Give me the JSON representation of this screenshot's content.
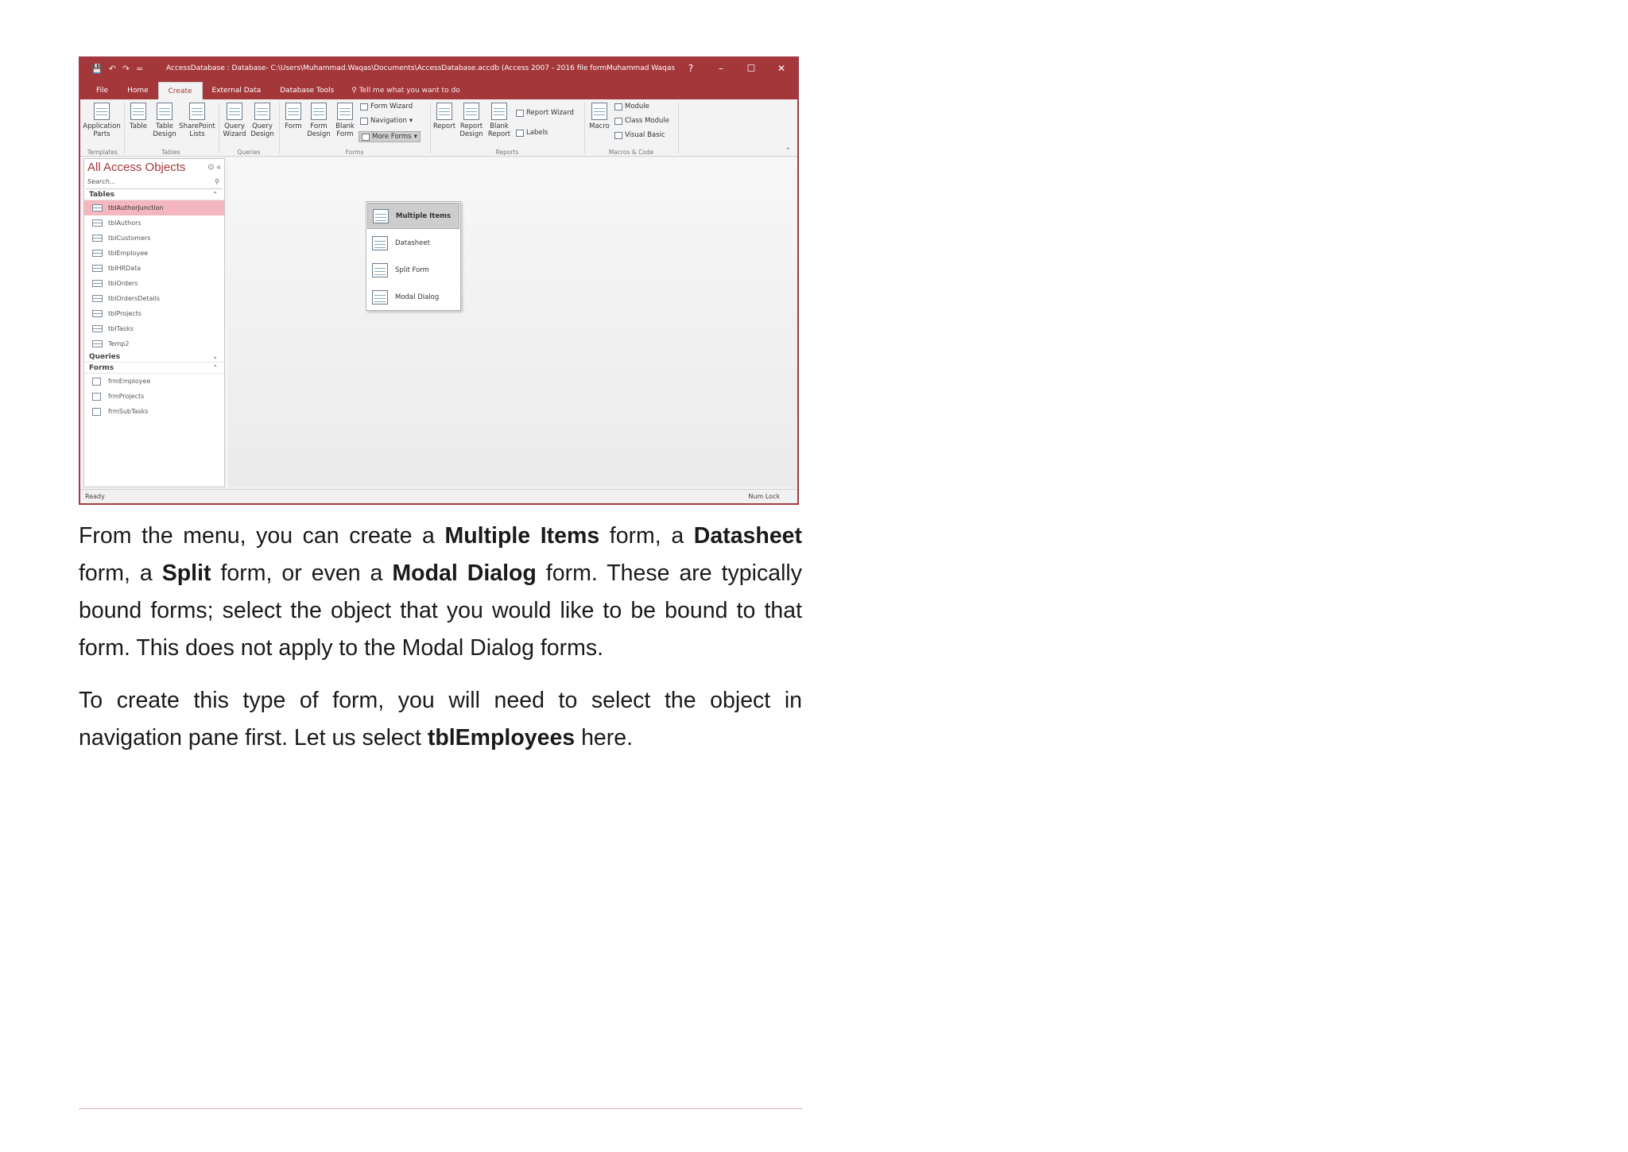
{
  "screenshot": {
    "qat": [
      "💾",
      "↶",
      "↷",
      "="
    ],
    "window_title": "AccessDatabase : Database- C:\\Users\\Muhammad.Waqas\\Documents\\AccessDatabase.accdb (Access 2007 - 2016 file format)...",
    "user": "Muhammad Waqas",
    "help": "?",
    "tabs": [
      "File",
      "Home",
      "Create",
      "External Data",
      "Database Tools"
    ],
    "tell_me": "Tell me what you want to do",
    "ribbon": {
      "application_parts": "Application Parts",
      "table": "Table",
      "table_design": "Table Design",
      "sharepoint_lists": "SharePoint Lists",
      "query_wizard": "Query Wizard",
      "query_design": "Query Design",
      "form": "Form",
      "form_design": "Form Design",
      "blank_form": "Blank Form",
      "form_wizard": "Form Wizard",
      "navigation": "Navigation",
      "more_forms": "More Forms",
      "report": "Report",
      "report_design": "Report Design",
      "blank_report": "Blank Report",
      "report_wizard": "Report Wizard",
      "labels": "Labels",
      "macro": "Macro",
      "module": "Module",
      "class_module": "Class Module",
      "visual_basic": "Visual Basic",
      "groups": [
        "Templates",
        "Tables",
        "Queries",
        "Forms",
        "Reports",
        "Macros & Code"
      ]
    },
    "nav_pane": {
      "title": "All Access Objects",
      "search_placeholder": "Search...",
      "tables_header": "Tables",
      "tables": [
        "tblAuthorJunction",
        "tblAuthors",
        "tblCustomers",
        "tblEmployee",
        "tblHRData",
        "tblOrders",
        "tblOrdersDetails",
        "tblProjects",
        "tblTasks",
        "Temp2"
      ],
      "queries_header": "Queries",
      "forms_header": "Forms",
      "forms": [
        "frmEmployee",
        "frmProjects",
        "frmSubTasks"
      ]
    },
    "more_forms_menu": [
      "Multiple Items",
      "Datasheet",
      "Split Form",
      "Modal Dialog"
    ],
    "status": {
      "left": "Ready",
      "right": "Num Lock"
    }
  },
  "text": {
    "p1": {
      "a": "From the menu, you can create a ",
      "b": "Multiple Items",
      "c": " form, a ",
      "d": "Datasheet",
      "e": " form, a ",
      "f": "Split",
      "g": " form, or even a ",
      "h": "Modal Dialog",
      "i": " form. These are typically bound forms; select the object that you would like to be bound to that form. This does not apply to the Modal Dialog forms."
    },
    "p2": {
      "a": "To create this type of form, you will need to select the object in navigation pane first. Let us select ",
      "b": "tblEmployees",
      "c": " here."
    }
  }
}
